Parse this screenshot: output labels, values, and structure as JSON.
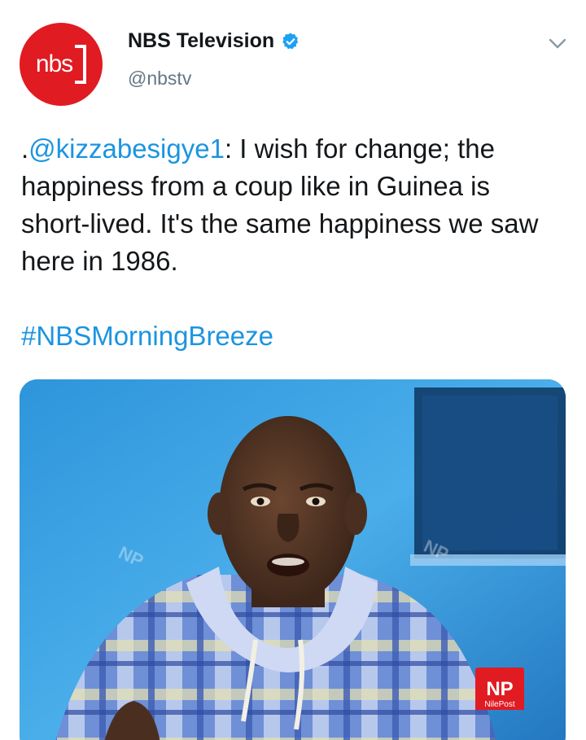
{
  "tweet": {
    "author": {
      "display_name": "NBS Television",
      "handle": "@nbstv",
      "verified": true,
      "avatar_text": "nbs",
      "avatar_color": "#e11b22"
    },
    "text": {
      "prefix": ".",
      "mention": "@kizzabesigye1",
      "body": ": I wish for change; the happiness from a coup like in Guinea is short-lived. It's the same happiness we saw here in 1986.",
      "hashtag": "#NBSMorningBreeze"
    },
    "media": {
      "watermark_logo": "NP",
      "watermark_label": "NilePost",
      "faint_watermark": "NP"
    }
  },
  "colors": {
    "link": "#1b95e0",
    "verified": "#1da1f2",
    "muted": "#657786"
  },
  "icons": {
    "verified": "verified-badge-icon",
    "menu": "chevron-down-icon"
  }
}
